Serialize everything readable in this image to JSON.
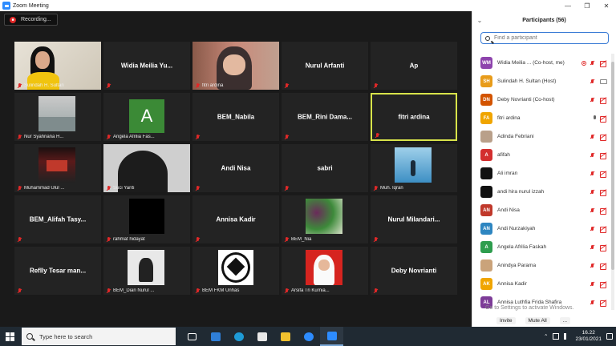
{
  "window": {
    "title": "Zoom Meeting"
  },
  "recording": {
    "label": "Recording..."
  },
  "tiles": [
    {
      "name": "Sulindah H. Sultan",
      "style": "photo",
      "photo": "girl-yellow"
    },
    {
      "name": "Widia  Meilia  Yu...",
      "style": "center"
    },
    {
      "name": "fitri ardina",
      "style": "photo",
      "photo": "hijab-glasses"
    },
    {
      "name": "Nurul Arfanti",
      "style": "center"
    },
    {
      "name": "Ap",
      "style": "center"
    },
    {
      "name": "Nur Syahriana H...",
      "style": "photo",
      "photo": "gray-screen"
    },
    {
      "name": "Angela Afrilia Fas...",
      "style": "letter",
      "letter": "A"
    },
    {
      "name": "BEM_Nabila",
      "style": "center"
    },
    {
      "name": "BEM_Rini  Dama...",
      "style": "center"
    },
    {
      "name": "fitri ardina",
      "style": "center",
      "active": true
    },
    {
      "name": "Muhammad Ulul ...",
      "style": "photo",
      "photo": "poster"
    },
    {
      "name": "Suci Yanti",
      "style": "photo",
      "photo": "dark-head"
    },
    {
      "name": "Andi Nisa",
      "style": "center"
    },
    {
      "name": "sabri",
      "style": "center"
    },
    {
      "name": "Muh. Iqran",
      "style": "photo",
      "photo": "sea"
    },
    {
      "name": "BEM_Alifah  Tasy...",
      "style": "center"
    },
    {
      "name": "rahmat hidayat",
      "style": "photo",
      "photo": "black"
    },
    {
      "name": "Annisa Kadir",
      "style": "center"
    },
    {
      "name": "BEM_Nia",
      "style": "photo",
      "photo": "vegetables"
    },
    {
      "name": "Nurul  Milandari...",
      "style": "center"
    },
    {
      "name": "Reflly Tesar man...",
      "style": "center"
    },
    {
      "name": "BEM_Dian Nurul ...",
      "style": "photo",
      "photo": "bw-girl"
    },
    {
      "name": "BEM FKM Unhas",
      "style": "photo",
      "photo": "logo"
    },
    {
      "name": "Arsifa Tri Kurnia...",
      "style": "photo",
      "photo": "red-hijab"
    },
    {
      "name": "Deby Novrianti",
      "style": "center"
    }
  ],
  "panel": {
    "title": "Participants (56)",
    "search_placeholder": "Find a participant",
    "participants": [
      {
        "initials": "WM",
        "color": "#8e44ad",
        "name": "Widia Meilia ...  (Co-host, me)",
        "video": "off",
        "recording": true
      },
      {
        "initials": "SH",
        "color": "#e89c1a",
        "name": "Sulindah H. Sultan (Host)",
        "video": "on"
      },
      {
        "initials": "DN",
        "color": "#d35400",
        "name": "Deby Novrianti (Co-host)",
        "video": "off"
      },
      {
        "initials": "FA",
        "color": "#f0a500",
        "name": "fitri ardina",
        "video": "off",
        "mic_on": true
      },
      {
        "initials": "",
        "color": "#b9a08a",
        "name": "Adinda Febriani",
        "video": "off"
      },
      {
        "initials": "A",
        "color": "#d32f2f",
        "name": "afifah",
        "video": "off"
      },
      {
        "initials": "",
        "color": "#111111",
        "name": "Ali imran",
        "video": "off"
      },
      {
        "initials": "",
        "color": "#111111",
        "name": "andi hira nurul izzah",
        "video": "off"
      },
      {
        "initials": "AN",
        "color": "#c0392b",
        "name": "Andi Nisa",
        "video": "off"
      },
      {
        "initials": "AN",
        "color": "#2e86c1",
        "name": "Andi Nurzakiyah",
        "video": "off"
      },
      {
        "initials": "A",
        "color": "#2e9d4e",
        "name": "Angela Afrilia Faskah",
        "video": "off"
      },
      {
        "initials": "",
        "color": "#caa37a",
        "name": "Anindya Parama",
        "video": "off"
      },
      {
        "initials": "AK",
        "color": "#f0a500",
        "name": "Annisa Kadir",
        "video": "off"
      },
      {
        "initials": "AL",
        "color": "#7d3c98",
        "name": "Annisa Luthfia Frida Shafira",
        "video": "off"
      }
    ],
    "watermark_line1": "Go to Settings to activate Windows.",
    "invite_label": "Invite",
    "mute_all_label": "Mute All",
    "more_label": "..."
  },
  "taskbar": {
    "search_placeholder": "Type here to search",
    "time": "16.22",
    "date": "23/01/2021"
  }
}
